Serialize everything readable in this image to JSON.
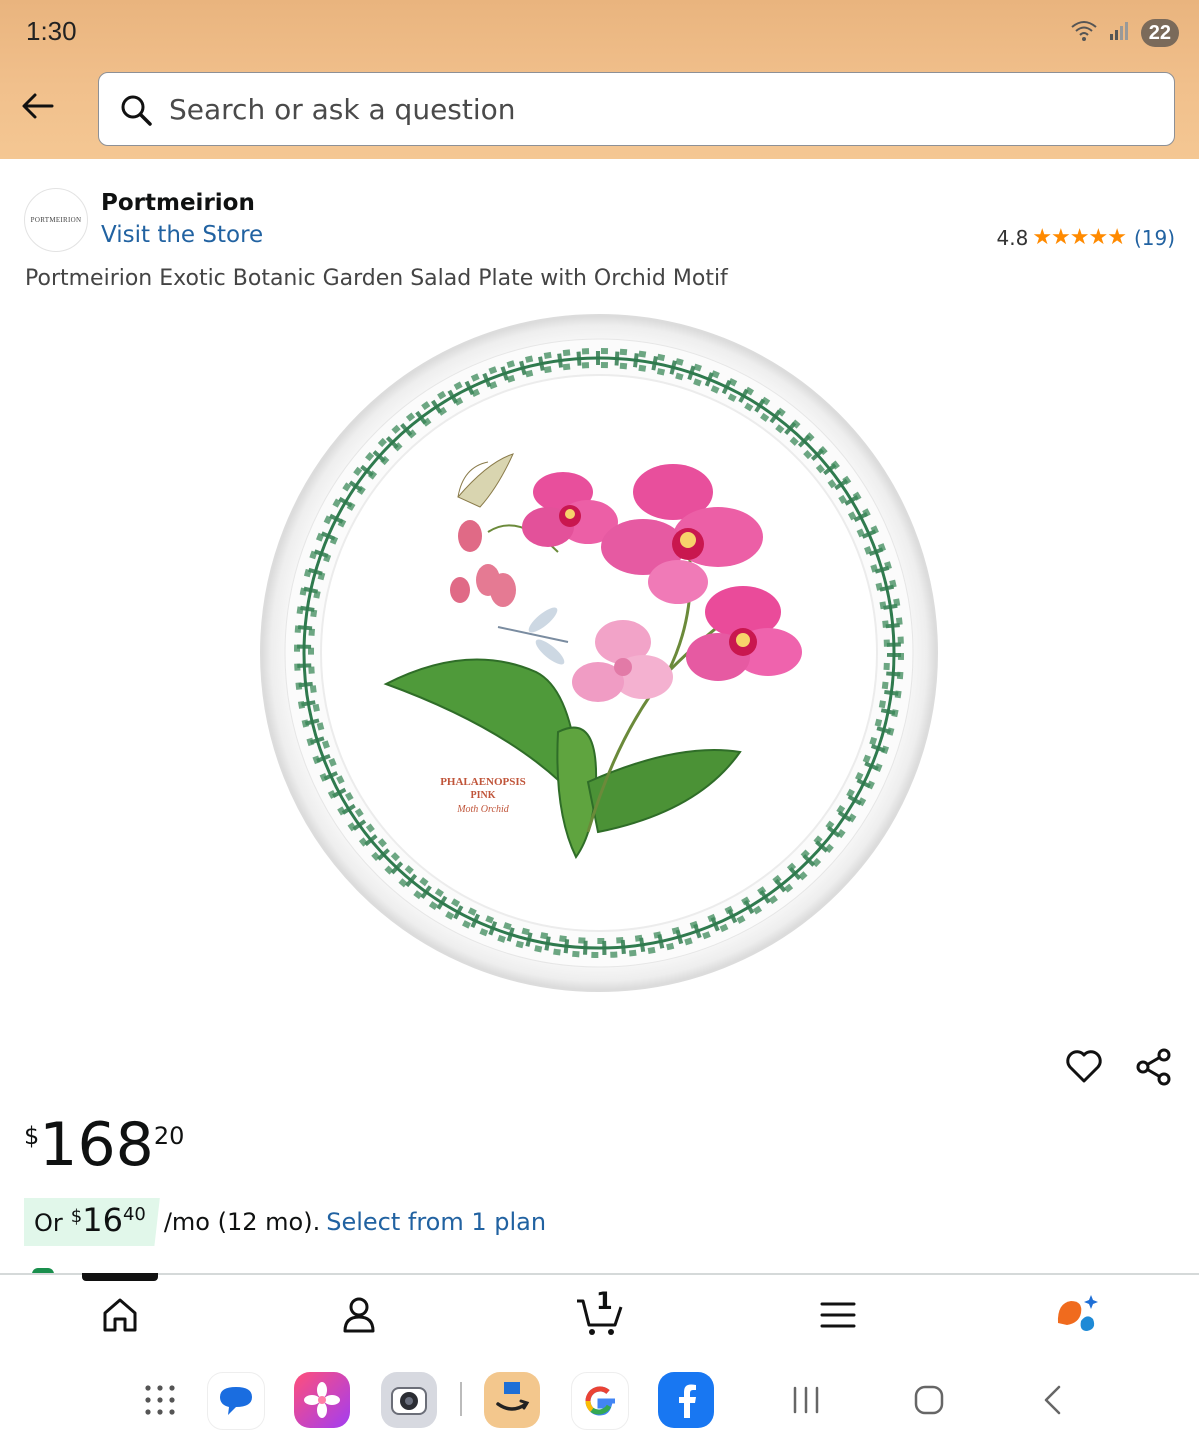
{
  "status_bar": {
    "time": "1:30",
    "battery": "22"
  },
  "search": {
    "placeholder": "Search or ask a question"
  },
  "brand": {
    "logo_text": "PORTMEIRION",
    "name": "Portmeirion",
    "store_link": "Visit the Store"
  },
  "rating": {
    "value": "4.8",
    "stars": "★★★★★",
    "count": "(19)"
  },
  "product": {
    "title": "Portmeirion Exotic Botanic Garden Salad Plate with Orchid Motif",
    "plate_label_line1": "PHALAENOPSIS",
    "plate_label_line2": "PINK",
    "plate_label_line3": "Moth Orchid"
  },
  "price": {
    "currency": "$",
    "whole": "168",
    "fraction": "20"
  },
  "installment": {
    "prefix": "Or",
    "currency": "$",
    "whole": "16",
    "fraction": "40",
    "suffix": "/mo (12 mo).",
    "link": "Select from 1 plan"
  },
  "bottom_nav": {
    "cart_count": "1"
  },
  "colors": {
    "header": "#f1c08c",
    "link": "#2162a1",
    "star": "#ff8a00",
    "installment_bg": "#e1f7ea"
  }
}
